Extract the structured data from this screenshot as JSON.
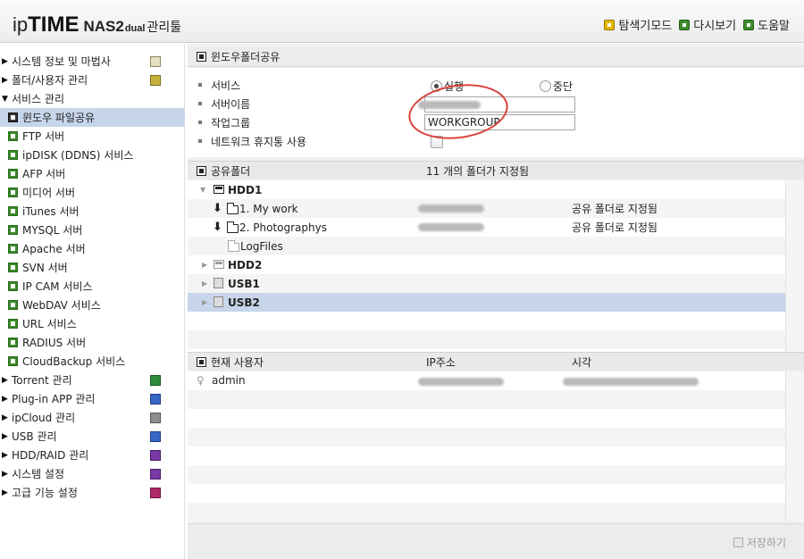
{
  "header": {
    "logo": {
      "ip": "ip",
      "time": "TIME",
      "model": "NAS2",
      "dual": "dual",
      "suffix": "관리툴"
    },
    "links": [
      {
        "label": "탐색기모드",
        "icon": "explorer-mode-icon"
      },
      {
        "label": "다시보기",
        "icon": "refresh-icon"
      },
      {
        "label": "도움말",
        "icon": "help-icon"
      }
    ]
  },
  "sidebar": {
    "items": [
      {
        "label": "시스템 정보 및 마법사",
        "type": "top",
        "arrow": "▶"
      },
      {
        "label": "폴더/사용자 관리",
        "type": "top",
        "arrow": "▶"
      },
      {
        "label": "서비스 관리",
        "type": "top",
        "arrow": "▼"
      },
      {
        "label": "윈도우 파일공유",
        "type": "sub",
        "selected": true
      },
      {
        "label": "FTP 서버",
        "type": "sub"
      },
      {
        "label": "ipDISK (DDNS) 서비스",
        "type": "sub"
      },
      {
        "label": "AFP 서버",
        "type": "sub"
      },
      {
        "label": "미디어 서버",
        "type": "sub"
      },
      {
        "label": "iTunes 서버",
        "type": "sub"
      },
      {
        "label": "MYSQL 서버",
        "type": "sub"
      },
      {
        "label": "Apache 서버",
        "type": "sub"
      },
      {
        "label": "SVN 서버",
        "type": "sub"
      },
      {
        "label": "IP CAM 서비스",
        "type": "sub"
      },
      {
        "label": "WebDAV 서비스",
        "type": "sub"
      },
      {
        "label": "URL 서비스",
        "type": "sub"
      },
      {
        "label": "RADIUS 서버",
        "type": "sub"
      },
      {
        "label": "CloudBackup 서비스",
        "type": "sub"
      },
      {
        "label": "Torrent 관리",
        "type": "top",
        "arrow": "▶"
      },
      {
        "label": "Plug-in APP 관리",
        "type": "top",
        "arrow": "▶"
      },
      {
        "label": "ipCloud 관리",
        "type": "top",
        "arrow": "▶"
      },
      {
        "label": "USB 관리",
        "type": "top",
        "arrow": "▶"
      },
      {
        "label": "HDD/RAID 관리",
        "type": "top",
        "arrow": "▶"
      },
      {
        "label": "시스템 설정",
        "type": "top",
        "arrow": "▶"
      },
      {
        "label": "고급 기능 설정",
        "type": "top",
        "arrow": "▶"
      }
    ]
  },
  "panel": {
    "title": "윈도우폴더공유",
    "settings": {
      "service_label": "서비스",
      "run_label": "실행",
      "stop_label": "중단",
      "service_value": "실행",
      "server_name_label": "서버이름",
      "server_name_value": "",
      "workgroup_label": "작업그룹",
      "workgroup_value": "WORKGROUP",
      "recycle_label": "네트워크 휴지통 사용",
      "recycle_checked": false
    }
  },
  "shared": {
    "header_label": "공유폴더",
    "count_text": "11 개의 폴더가 지정됨",
    "rows": [
      {
        "name": "HDD1",
        "status": ""
      },
      {
        "name": "1. My work",
        "status": "공유 폴더로 지정됨"
      },
      {
        "name": "2. Photographys",
        "status": "공유 폴더로 지정됨"
      },
      {
        "name": "LogFiles",
        "status": ""
      },
      {
        "name": "HDD2",
        "status": ""
      },
      {
        "name": "USB1",
        "status": ""
      },
      {
        "name": "USB2",
        "status": ""
      }
    ]
  },
  "users": {
    "col_user": "현재 사용자",
    "col_ip": "IP주소",
    "col_time": "시각",
    "rows": [
      {
        "name": "admin"
      }
    ]
  },
  "footer": {
    "save_label": "저장하기"
  }
}
